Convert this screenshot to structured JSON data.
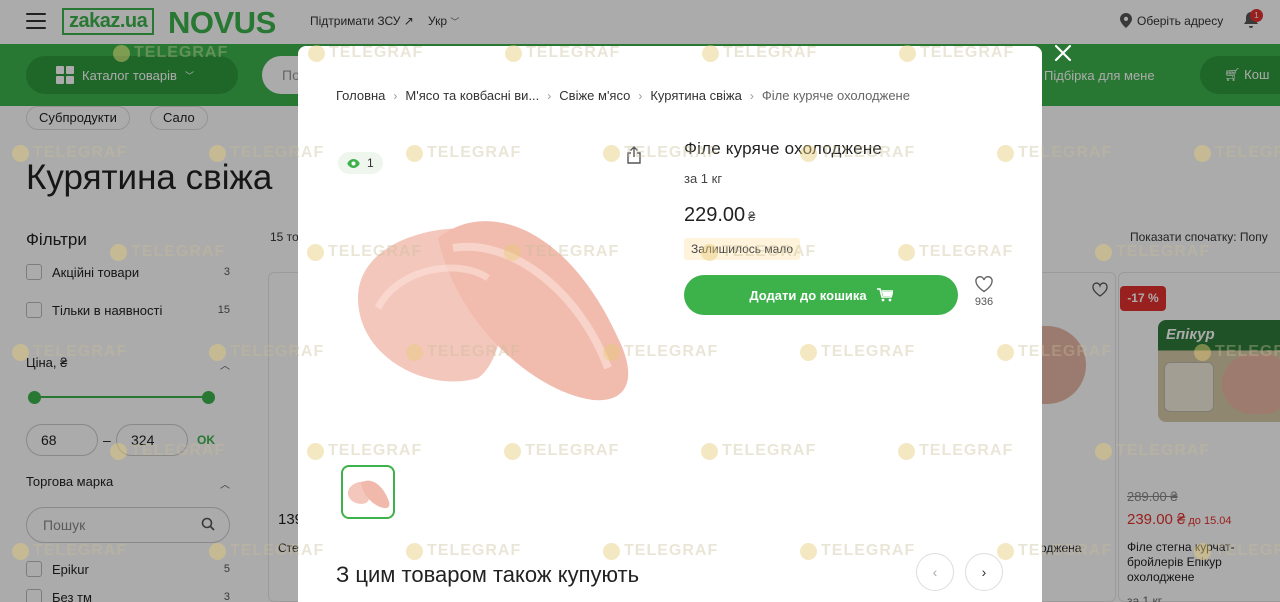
{
  "header": {
    "logo_zakaz": "zakaz.ua",
    "logo_store": "NOVUS",
    "support_link": "Підтримати ЗСУ ↗",
    "language": "Укр",
    "address_label": "Оберіть адресу",
    "notifications_count": "1"
  },
  "nav": {
    "catalog_label": "Катало​г товарів",
    "search_placeholder": "По",
    "picks_label": "Підбірка для мене",
    "cart_label": "Кош"
  },
  "category": {
    "chips": [
      "Субпродукти",
      "Сало"
    ],
    "title": "Курятина свіжа",
    "count_label": "15 то",
    "sort_label": "Показати спочатку: Попу"
  },
  "filters": {
    "title": "Фільтри",
    "promo_label": "Акційні товари",
    "promo_count": "3",
    "instock_label": "Тільки в наявності",
    "instock_count": "15",
    "price_title": "Ціна, ₴",
    "price_min": "68",
    "price_max": "324",
    "ok_label": "OK",
    "brand_title": "Торгова марка",
    "brand_search_placeholder": "Пошук",
    "brands": [
      {
        "label": "Epikur",
        "count": "5"
      },
      {
        "label": "Без тм",
        "count": "3"
      }
    ]
  },
  "cards": {
    "left_price": "139",
    "left_name": "Сте",
    "mid_name": "оджена",
    "discount": "-17 %",
    "pack_brand": "Епікур",
    "old_price": "289.00 ₴",
    "new_price": "239.00 ₴",
    "until": "до 15.04",
    "name": "Філе стегна курчат-бройлерів Епікур охолоджене",
    "weight": "за 1 кг"
  },
  "modal": {
    "breadcrumbs": [
      "Головна",
      "М'ясо та ковбасні ви...",
      "Свіже м'ясо",
      "Курятина свіжа",
      "Філе куряче охолоджене"
    ],
    "views": "1",
    "product_title": "Філе куряче охолоджене",
    "unit": "за 1 кг",
    "price": "229.00",
    "currency": "₴",
    "stock_status": "Залишилось мало",
    "add_to_cart": "Додати до кошика",
    "favorites_count": "936",
    "also_bought_title": "З цим товаром також купують"
  },
  "watermark": "TELEGRAF",
  "colors": {
    "brand_green": "#3db24b",
    "sale_red": "#e3312d",
    "stock_bg": "#fff3dc"
  }
}
